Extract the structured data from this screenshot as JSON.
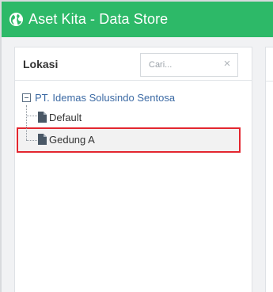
{
  "header": {
    "app_title": "Aset Kita - Data Store",
    "icon": "globe-icon"
  },
  "panel": {
    "title": "Lokasi",
    "search": {
      "placeholder": "Cari...",
      "value": "",
      "clear_icon": "close-icon"
    },
    "tree": {
      "root": {
        "label": "PT. Idemas Solusindo Sentosa",
        "expanded": true,
        "toggle_icon": "collapse-box-icon"
      },
      "children": [
        {
          "label": "Default",
          "icon": "file-icon",
          "selected": false
        },
        {
          "label": "Gedung A",
          "icon": "file-icon",
          "selected": true
        }
      ]
    }
  },
  "colors": {
    "header_bg": "#2db968",
    "root_link": "#3c6aa4",
    "highlight_border": "#e3262f"
  }
}
